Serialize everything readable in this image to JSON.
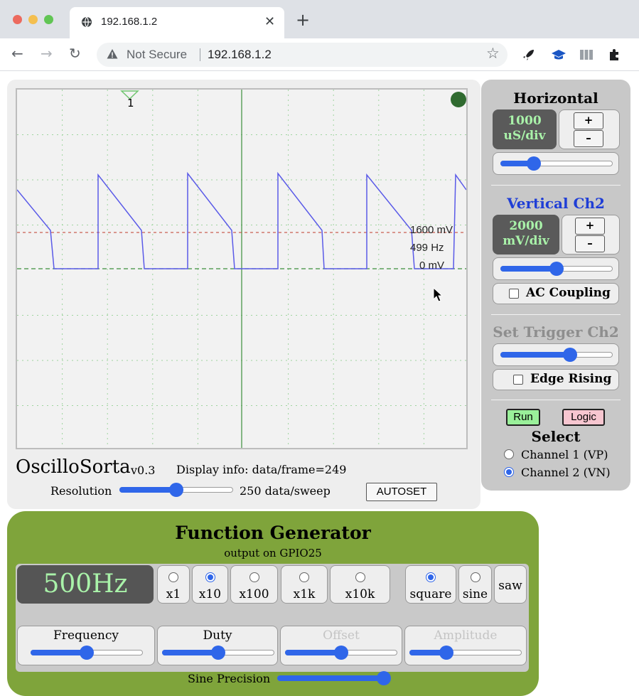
{
  "browser": {
    "tab_title": "192.168.1.2",
    "tab_close": "✕",
    "new_tab": "+",
    "security_label": "Not Secure",
    "url": "192.168.1.2"
  },
  "scope": {
    "trigger_marker_label": "1",
    "readouts": {
      "level": "1600 mV",
      "frequency": "499 Hz",
      "offset": "0 mV"
    },
    "app_name": "OscilloSorta",
    "version": "v0.3",
    "display_info": "Display info: data/frame=249",
    "resolution_label": "Resolution",
    "resolution_value": "250 data/sweep",
    "resolution_level": 0.5,
    "autoset_label": "AUTOSET"
  },
  "controls": {
    "horizontal": {
      "title": "Horizontal",
      "value": "1000",
      "unit": "uS/div",
      "plus": "+",
      "minus": "–",
      "level": 0.3
    },
    "vertical": {
      "title": "Vertical Ch2",
      "value": "2000",
      "unit": "mV/div",
      "plus": "+",
      "minus": "–",
      "level": 0.5,
      "ac_coupling_label": "AC Coupling",
      "ac_coupling_checked": false
    },
    "trigger": {
      "title": "Set Trigger Ch2",
      "level": 0.62,
      "edge_label": "Edge Rising",
      "edge_checked": false
    },
    "run_label": "Run",
    "logic_label": "Logic",
    "select_title": "Select",
    "channels": [
      {
        "label": "Channel 1 (VP)",
        "selected": false
      },
      {
        "label": "Channel 2 (VN)",
        "selected": true
      }
    ]
  },
  "function_generator": {
    "title": "Function Generator",
    "subtitle": "output on GPIO25",
    "frequency_display": "500Hz",
    "multipliers": [
      {
        "label": "x1",
        "selected": false
      },
      {
        "label": "x10",
        "selected": true
      },
      {
        "label": "x100",
        "selected": false
      },
      {
        "label": "x1k",
        "selected": false
      },
      {
        "label": "x10k",
        "selected": false
      }
    ],
    "waveforms": [
      {
        "label": "square",
        "selected": true
      },
      {
        "label": "sine",
        "selected": false
      },
      {
        "label": "saw",
        "selected": false
      }
    ],
    "knobs": [
      {
        "label": "Frequency",
        "level": 0.5,
        "enabled": true
      },
      {
        "label": "Duty",
        "level": 0.5,
        "enabled": true
      },
      {
        "label": "Offset",
        "level": 0.5,
        "enabled": false
      },
      {
        "label": "Amplitude",
        "level": 0.33,
        "enabled": false
      }
    ],
    "sine_precision_label": "Sine Precision",
    "sine_precision_level": 1.0
  },
  "colors": {
    "trace": "#5a5ae8",
    "grid": "#9fd49f",
    "center_line": "#3c8f3c",
    "trigger_line": "#c0392b",
    "function_generator_bg": "#7fa43b",
    "display_text": "#a9f2a9",
    "slider_accent": "#2f66e9"
  }
}
